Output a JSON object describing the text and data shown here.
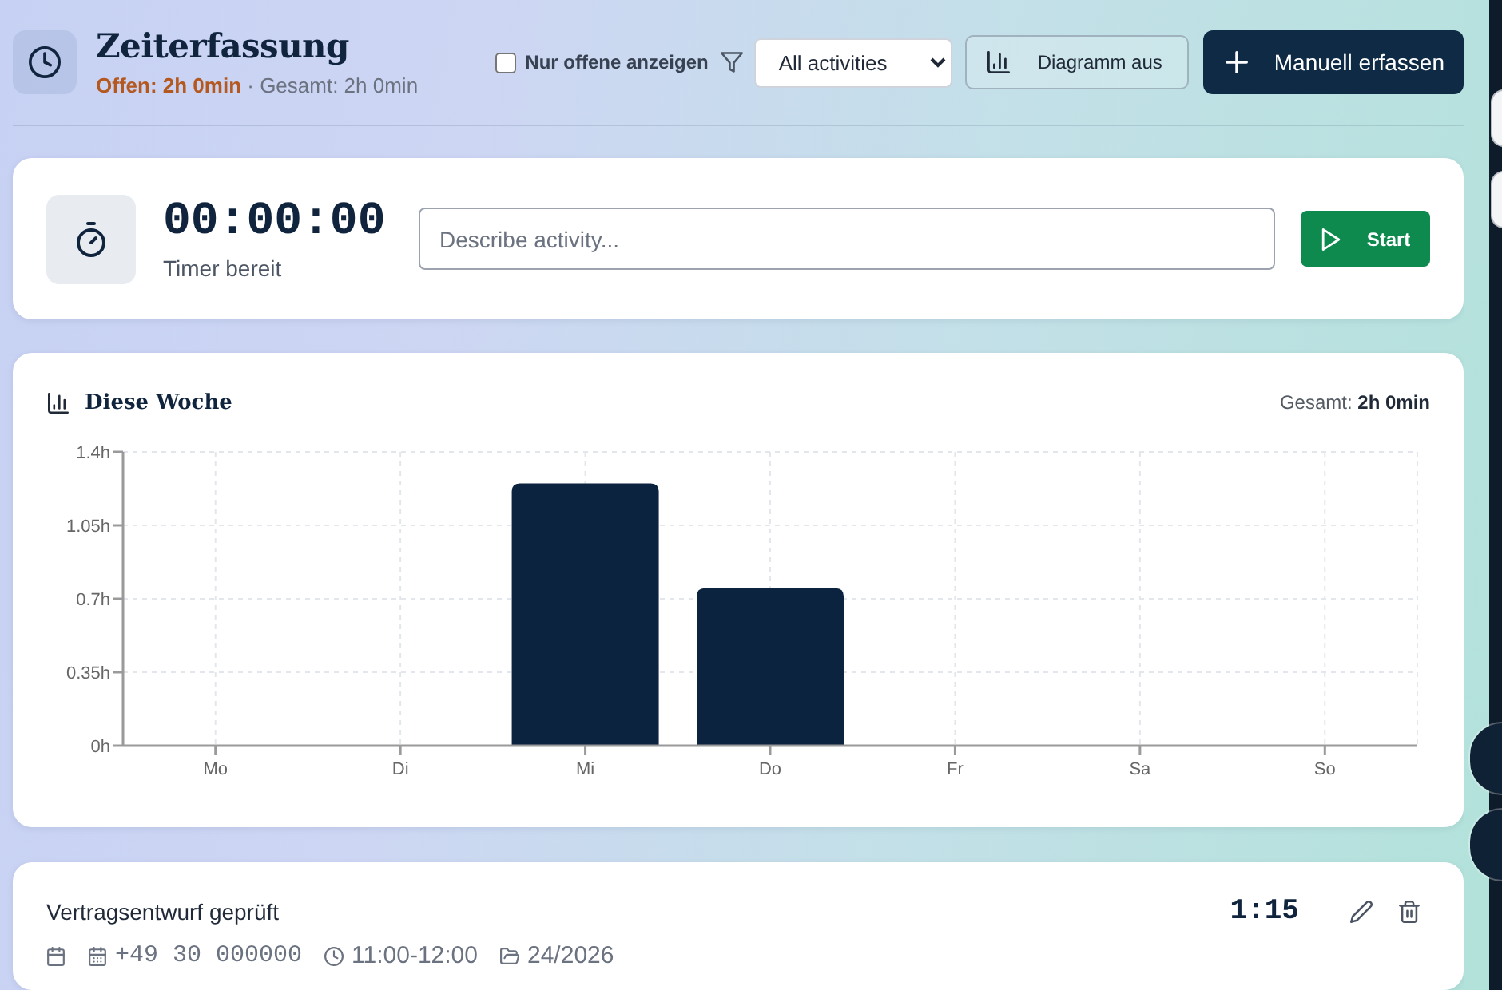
{
  "header": {
    "title": "Zeiterfassung",
    "summary": "**Offen: 2h 0min** · Gesamt: 2h 0min"
  },
  "toolbar": {
    "open_only": {
      "label": "Nur offene anzeigen",
      "checked": false
    },
    "activity_filter": {
      "value": "All activities"
    },
    "chart_toggle": {
      "label": "Diagramm aus"
    },
    "add_button": {
      "label": "Manuell erfassen"
    }
  },
  "timer": {
    "time": "00:00:00",
    "status": "Timer bereit",
    "input": {
      "placeholder": "Describe activity..."
    },
    "start_button": {
      "label": "Start"
    }
  },
  "week_chart": {
    "title": "Diese Woche",
    "total": "Gesamt: **2h 0min**",
    "chart_data": {
      "type": "bar",
      "grid": true,
      "categories": [
        "Mo",
        "Di",
        "Mi",
        "Do",
        "Fr",
        "Sa",
        "So"
      ],
      "values": [
        0,
        0,
        1.25,
        0.75,
        0,
        0,
        0
      ],
      "ylim": [
        0,
        1.4
      ],
      "yticks": [
        {
          "value": 0,
          "label": "0h"
        },
        {
          "value": 0.35,
          "label": "0.35h"
        },
        {
          "value": 0.7,
          "label": "0.7h"
        },
        {
          "value": 1.05,
          "label": "1.05h"
        },
        {
          "value": 1.4,
          "label": "1.4h"
        }
      ]
    }
  },
  "entries": [
    {
      "title": "Vertragsentwurf geprüft",
      "duration": "1:15",
      "meta": [
        {
          "kind": "date"
        },
        {
          "kind": "calendar",
          "text": "+49 30 000000"
        },
        {
          "kind": "time",
          "text": "11:00-12:00"
        },
        {
          "kind": "project",
          "text": "24/2026"
        }
      ]
    }
  ]
}
